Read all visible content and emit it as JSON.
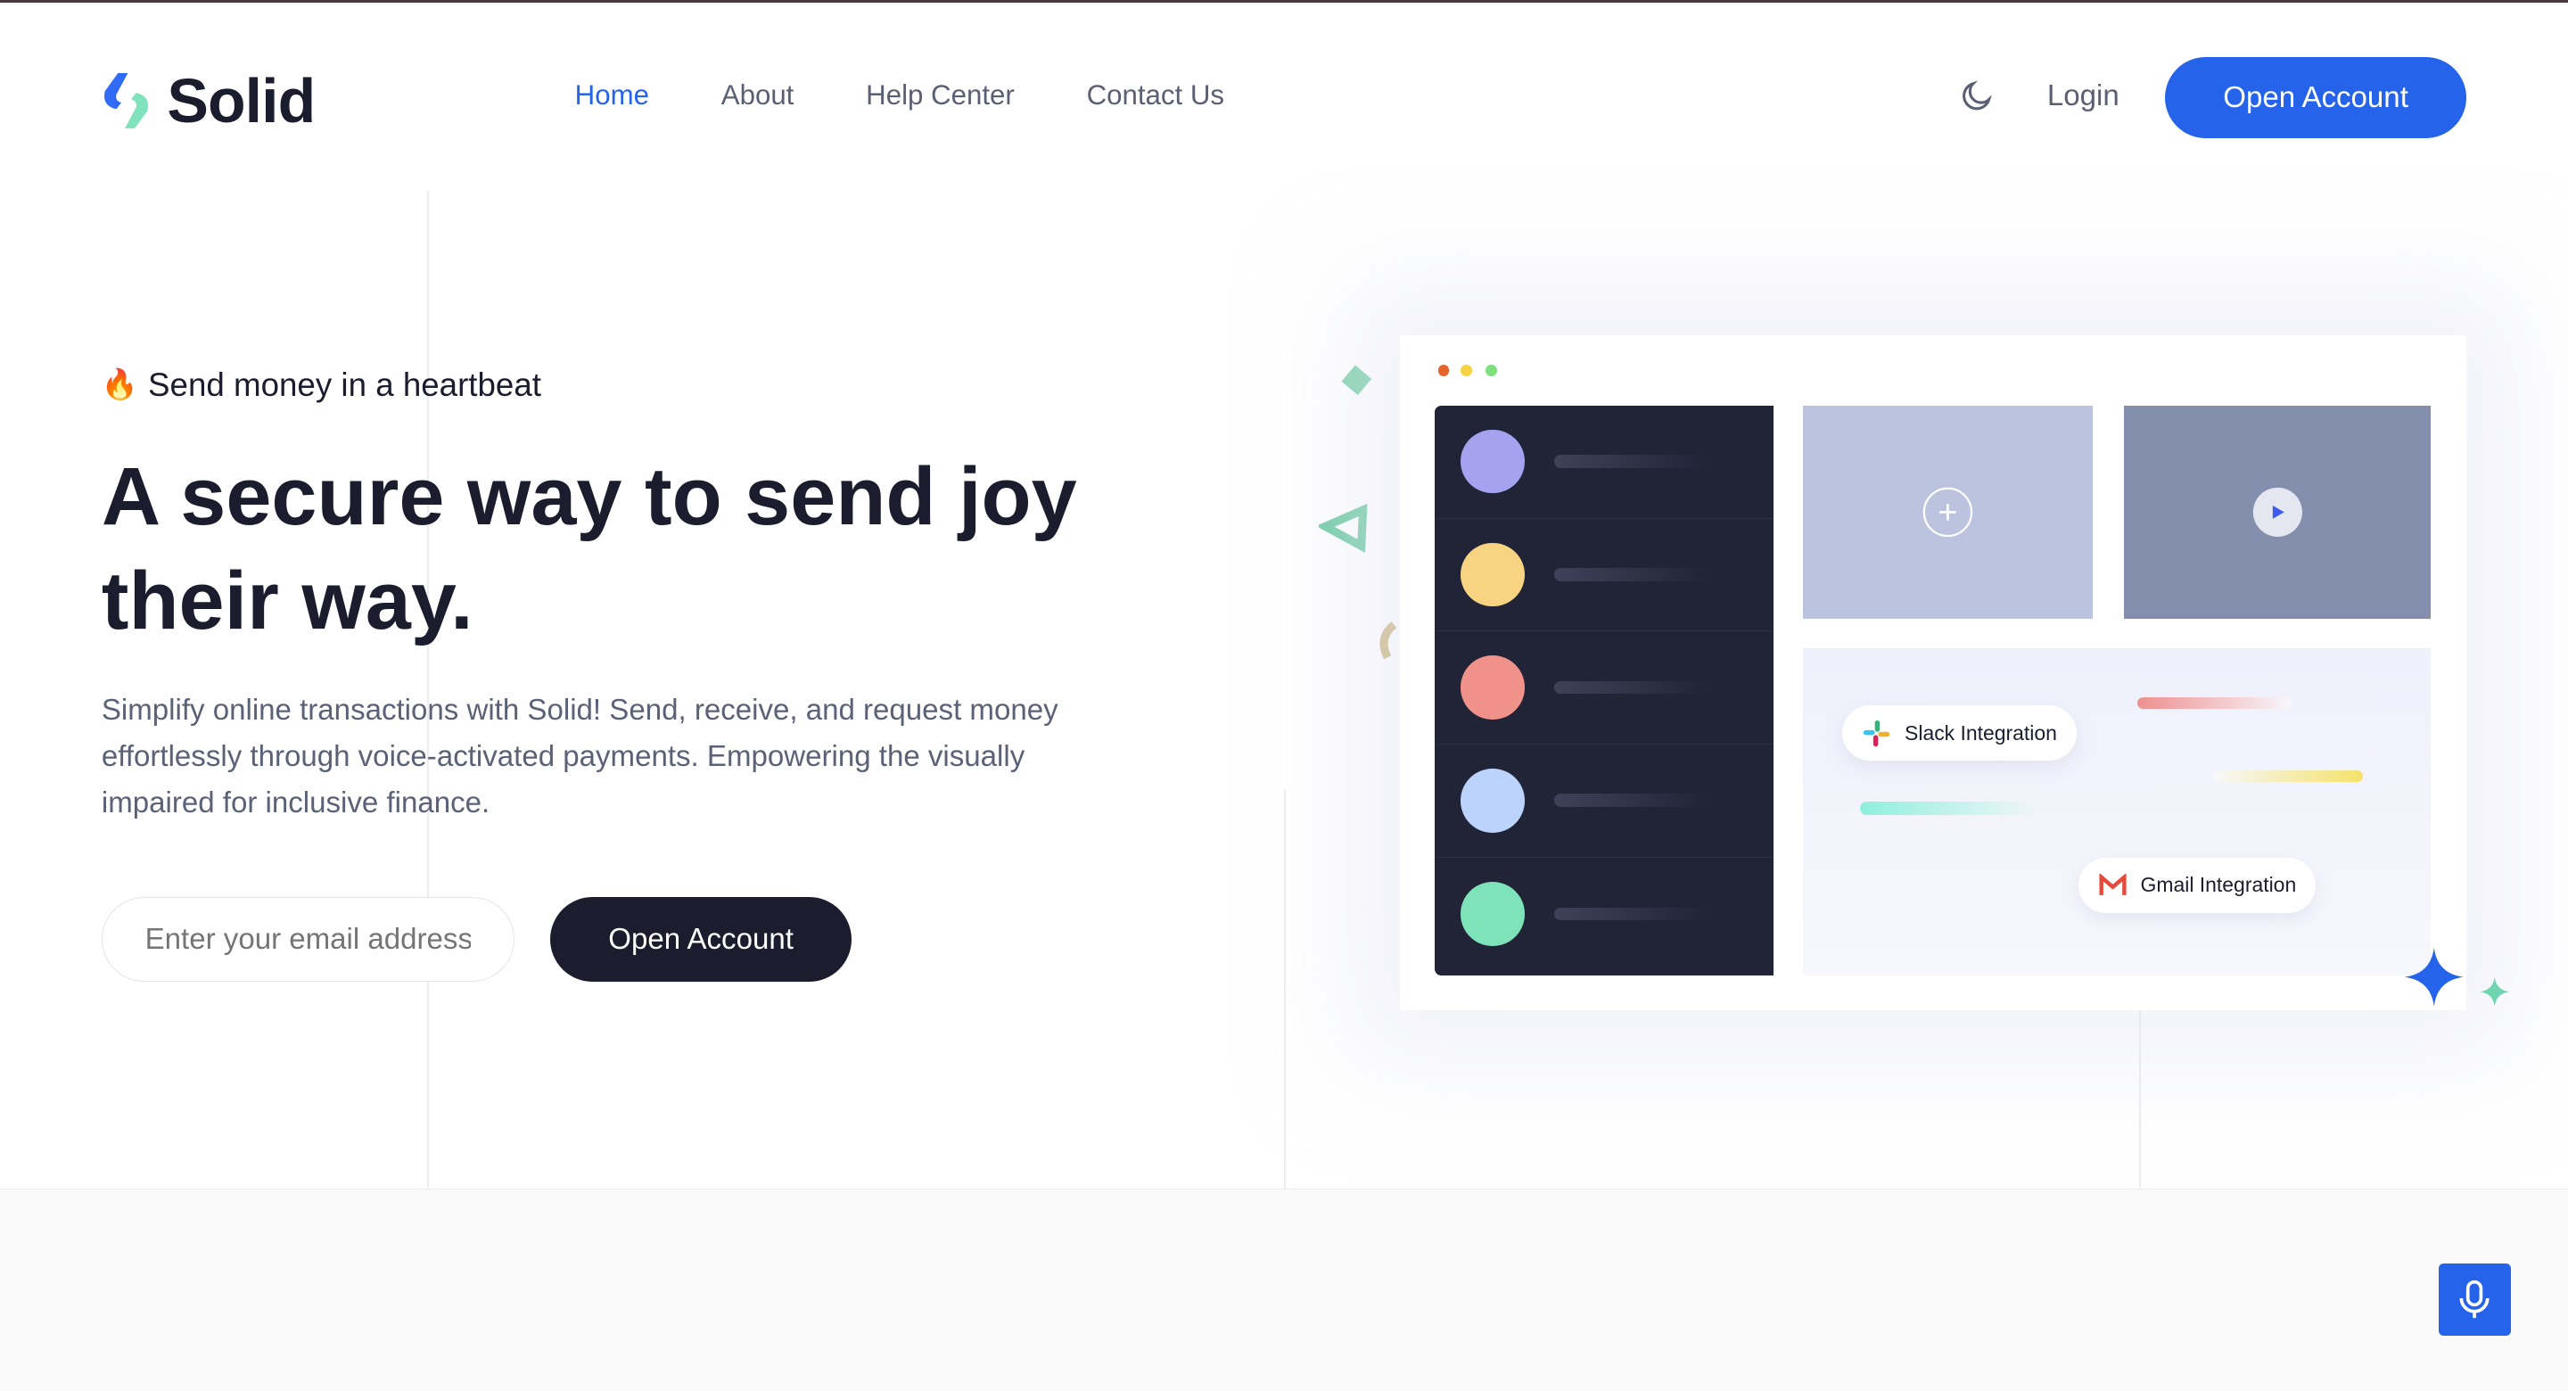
{
  "brand": {
    "name": "Solid",
    "logo_colors": [
      "#2f6bf5",
      "#7fe3bd"
    ]
  },
  "nav": {
    "items": [
      {
        "label": "Home",
        "active": true
      },
      {
        "label": "About"
      },
      {
        "label": "Help Center"
      },
      {
        "label": "Contact Us"
      }
    ]
  },
  "header": {
    "theme_icon": "moon-icon",
    "login": "Login",
    "cta": "Open Account"
  },
  "hero": {
    "tagline_icon": "fire-emoji",
    "tagline": "Send money in a heartbeat",
    "title": "A secure way to send joy their way.",
    "description": "Simplify online transactions with Solid! Send, receive, and request money effortlessly through voice-activated payments. Empowering the visually impaired for inclusive finance.",
    "email_placeholder": "Enter your email address",
    "cta": "Open Account"
  },
  "mockup": {
    "window_dots": [
      "#e8632a",
      "#f7d343",
      "#7ee07a"
    ],
    "avatar_colors": [
      "#a5a3f0",
      "#f8d482",
      "#f0918a",
      "#bcd4fb",
      "#7ee3b8"
    ],
    "integrations": {
      "slack": "Slack Integration",
      "gmail": "Gmail Integration"
    }
  },
  "colors": {
    "accent": "#2563eb",
    "dark": "#1b1d2e"
  },
  "voice_button_icon": "microphone-icon"
}
